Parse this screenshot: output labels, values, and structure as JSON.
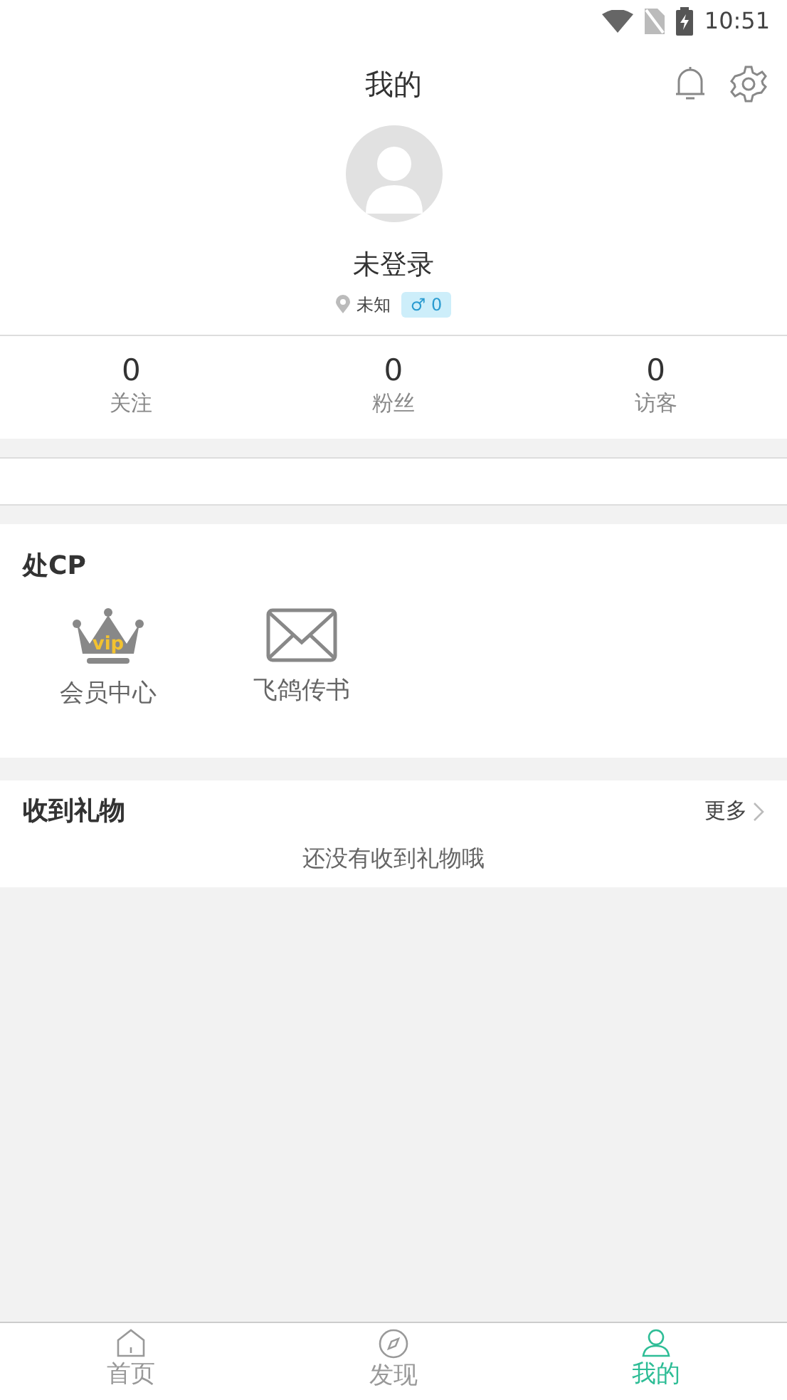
{
  "status_bar": {
    "time": "10:51"
  },
  "header": {
    "title": "我的"
  },
  "profile": {
    "name": "未登录",
    "location": "未知",
    "gender_symbol": "♂",
    "gender_count": "0"
  },
  "stats": [
    {
      "value": "0",
      "label": "关注"
    },
    {
      "value": "0",
      "label": "粉丝"
    },
    {
      "value": "0",
      "label": "访客"
    }
  ],
  "cp_section": {
    "title": "处CP",
    "items": [
      {
        "kind": "vip",
        "label": "会员中心",
        "icon_text": "vip"
      },
      {
        "kind": "mail",
        "label": "飞鸽传书"
      }
    ]
  },
  "gifts": {
    "title": "收到礼物",
    "more": "更多",
    "empty_text": "还没有收到礼物哦"
  },
  "tab_bar": [
    {
      "kind": "home",
      "label": "首页",
      "selected": false
    },
    {
      "kind": "discover",
      "label": "发现",
      "selected": false
    },
    {
      "kind": "me",
      "label": "我的",
      "selected": true
    }
  ]
}
